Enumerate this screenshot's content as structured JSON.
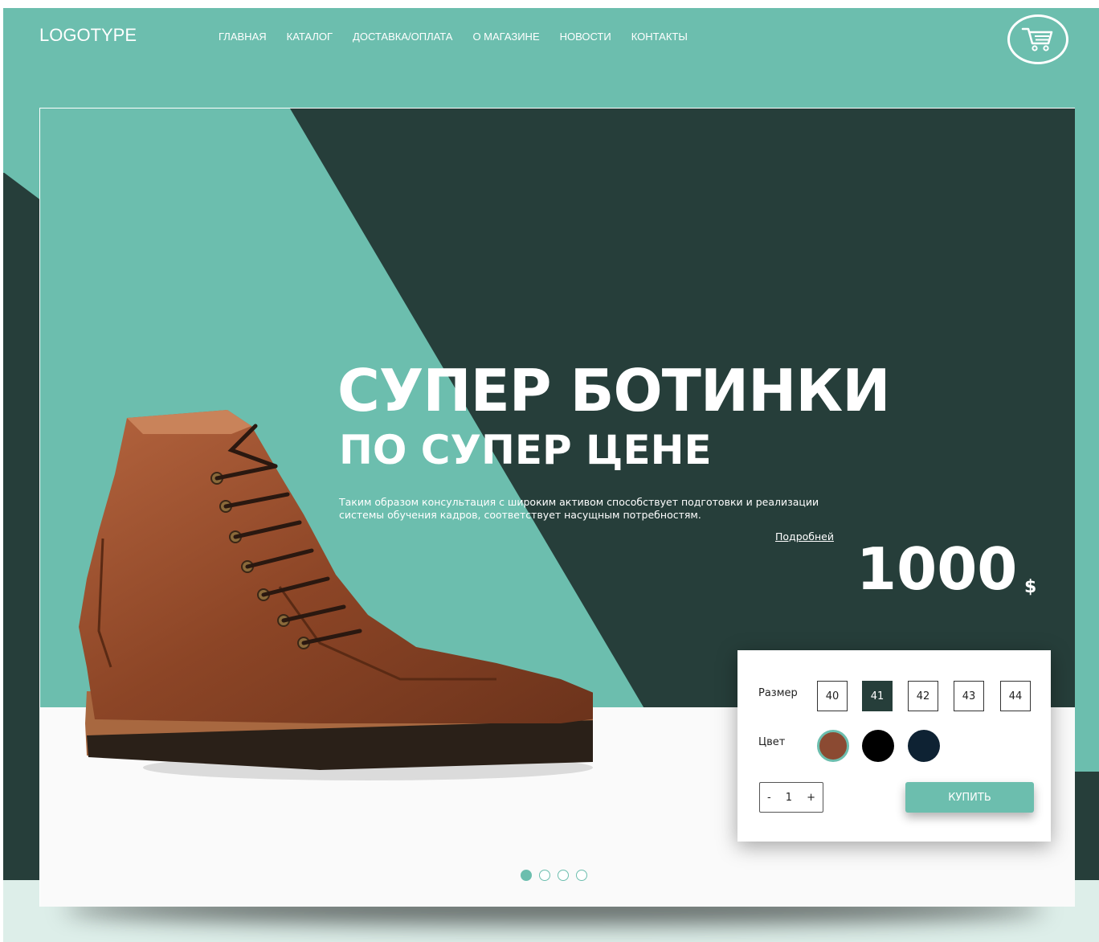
{
  "header": {
    "logo": "LOGOTYPE",
    "nav": [
      "ГЛАВНАЯ",
      "КАТАЛОГ",
      "ДОСТАВКА/ОПЛАТА",
      "О МАГАЗИНЕ",
      "НОВОСТИ",
      "КОНТАКТЫ"
    ],
    "cart_icon": "cart-icon"
  },
  "hero": {
    "title": "СУПЕР БОТИНКИ",
    "subtitle": "ПО СУПЕР ЦЕНЕ",
    "description": "Таким образом консультация с широким активом способствует подготовки и реализации системы обучения кадров, соответствует насущным потребностям.",
    "more_link": "Подробней",
    "price": "1000",
    "currency": "$"
  },
  "order_panel": {
    "size_label": "Размер",
    "sizes": [
      "40",
      "41",
      "42",
      "43",
      "44"
    ],
    "selected_size": "41",
    "color_label": "Цвет",
    "colors": [
      "#8b4a32",
      "#000000",
      "#0e2233"
    ],
    "selected_color": "#8b4a32",
    "quantity": {
      "minus": "-",
      "value": "1",
      "plus": "+"
    },
    "buy_label": "КУПИТЬ"
  },
  "slider": {
    "count": 4,
    "active": 0
  },
  "colors": {
    "teal": "#6cbeae",
    "dark_green": "#263e3a",
    "light": "#fafafa"
  }
}
